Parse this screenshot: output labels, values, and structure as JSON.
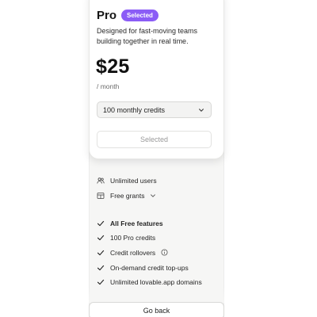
{
  "plan": {
    "name": "Pro",
    "badge": "Selected",
    "description": "Designed for fast-moving teams building together in real time.",
    "price": "$25",
    "period": "/ month",
    "credits_select": {
      "value": "100 monthly credits"
    },
    "cta_label": "Selected"
  },
  "extras": [
    {
      "icon": "users-icon",
      "label": "Unlimited users"
    },
    {
      "icon": "grant-icon",
      "label": "Free grants"
    }
  ],
  "features": [
    {
      "label": "All Free features",
      "bold": true
    },
    {
      "label": "100 Pro credits"
    },
    {
      "label": "Credit rollovers"
    },
    {
      "label": "On-demand credit top-ups"
    },
    {
      "label": "Unlimited lovable.app domains"
    }
  ],
  "footer": {
    "go_back": "Go back"
  },
  "colors": {
    "badge": "#8b5cf6",
    "panel": "#f6f6f5",
    "card": "#ffffff"
  }
}
